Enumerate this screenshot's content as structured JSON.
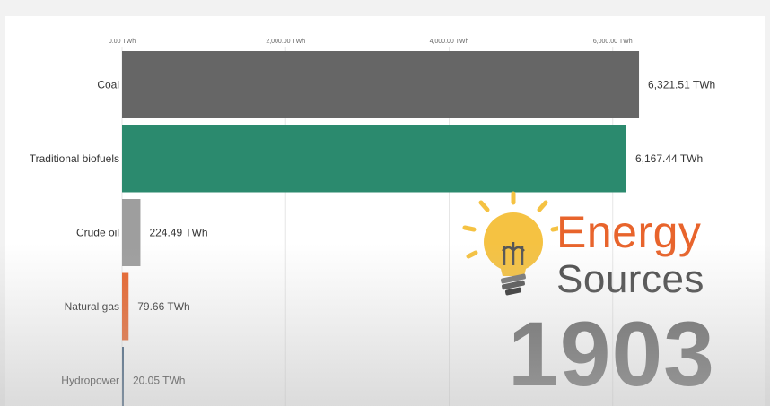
{
  "chart_data": {
    "type": "bar",
    "orientation": "horizontal",
    "categories": [
      "Coal",
      "Traditional biofuels",
      "Crude oil",
      "Natural gas",
      "Hydropower"
    ],
    "values": [
      6321.51,
      6167.44,
      224.49,
      79.66,
      20.05
    ],
    "value_labels": [
      "6,321.51 TWh",
      "6,167.44 TWh",
      "224.49 TWh",
      "79.66 TWh",
      "20.05 TWh"
    ],
    "colors": [
      "#666666",
      "#2b8a6e",
      "#9e9e9e",
      "#e8642c",
      "#3a5a7a"
    ],
    "xlim": [
      0,
      6600
    ],
    "ticks": [
      {
        "value": 0,
        "label": "0.00 TWh"
      },
      {
        "value": 2000,
        "label": "2,000.00 TWh"
      },
      {
        "value": 4000,
        "label": "4,000.00 TWh"
      },
      {
        "value": 6000,
        "label": "6,000.00 TWh"
      }
    ],
    "grid": true,
    "year": "1903"
  },
  "logo": {
    "word1": "Energy",
    "word2": "Sources",
    "word1_color": "#e8642c",
    "word2_color": "#4d4d4d",
    "bulb_color": "#f5c242",
    "icon": "lightbulb-icon"
  }
}
